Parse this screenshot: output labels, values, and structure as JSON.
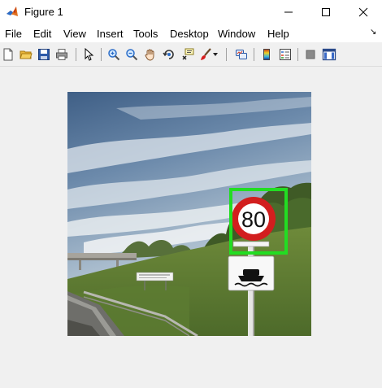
{
  "window": {
    "title": "Figure 1",
    "icon": "matlab-icon",
    "controls": [
      "minimize-icon",
      "maximize-icon",
      "close-icon"
    ]
  },
  "menu": {
    "items": [
      "File",
      "Edit",
      "View",
      "Insert",
      "Tools",
      "Desktop",
      "Window",
      "Help"
    ],
    "overflow_arrow": "↘"
  },
  "toolbar": {
    "buttons": [
      "new-figure-icon",
      "open-file-icon",
      "save-figure-icon",
      "print-figure-icon",
      "edit-plot-arrow-icon",
      "zoom-in-icon",
      "zoom-out-icon",
      "pan-hand-icon",
      "rotate-3d-icon",
      "data-cursor-icon",
      "brush-icon",
      "link-plot-icon",
      "colorbar-icon",
      "legend-icon",
      "hide-plot-tools-icon",
      "show-plot-tools-icon"
    ]
  },
  "figure": {
    "image_content": "road-scene-photo",
    "sign_text": "80",
    "detection_box_color": "#22dd22"
  }
}
